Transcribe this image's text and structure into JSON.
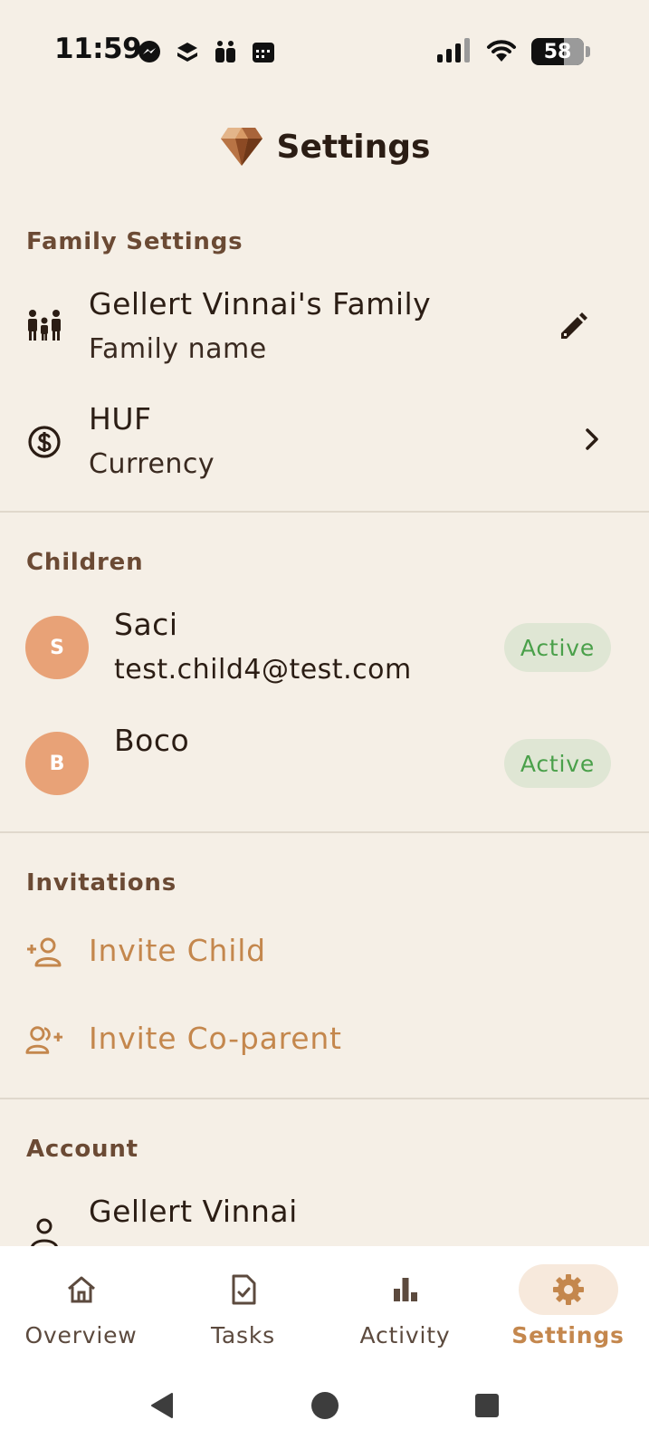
{
  "status_bar": {
    "time": "11:59",
    "battery": "58",
    "left_icons": [
      "messenger-icon",
      "stacked-app-icon",
      "gift-icon",
      "calendar-icon"
    ],
    "right_icons": [
      "signal-icon",
      "wifi-icon",
      "battery-icon"
    ]
  },
  "header": {
    "title": "Settings",
    "logo_icon": "gem-logo-icon"
  },
  "family_settings": {
    "header": "Family Settings",
    "family_name": {
      "value": "Gellert Vinnai's Family",
      "label": "Family name",
      "icon": "family-icon",
      "action_icon": "edit-pencil-icon"
    },
    "currency": {
      "value": "HUF",
      "label": "Currency",
      "icon": "dollar-circle-icon",
      "action_icon": "chevron-right-icon"
    }
  },
  "children": {
    "header": "Children",
    "items": [
      {
        "initial": "S",
        "name": "Saci",
        "email": "test.child4@test.com",
        "status": "Active"
      },
      {
        "initial": "B",
        "name": "Boco",
        "email": "",
        "status": "Active"
      }
    ]
  },
  "invitations": {
    "header": "Invitations",
    "items": [
      {
        "label": "Invite Child",
        "icon": "person-add-icon"
      },
      {
        "label": "Invite Co-parent",
        "icon": "group-add-icon"
      }
    ]
  },
  "account": {
    "header": "Account",
    "name": "Gellert Vinnai",
    "icon": "person-icon"
  },
  "bottom_nav": {
    "items": [
      {
        "label": "Overview",
        "icon": "home-icon",
        "active": false
      },
      {
        "label": "Tasks",
        "icon": "task-check-icon",
        "active": false
      },
      {
        "label": "Activity",
        "icon": "bar-chart-icon",
        "active": false
      },
      {
        "label": "Settings",
        "icon": "gear-icon",
        "active": true
      }
    ]
  },
  "colors": {
    "background": "#f5efe6",
    "accent": "#c4874d",
    "avatar": "#e8a277",
    "badge_bg": "#dfe6d4",
    "badge_text": "#4aa04a",
    "section_header": "#6b4a34"
  }
}
